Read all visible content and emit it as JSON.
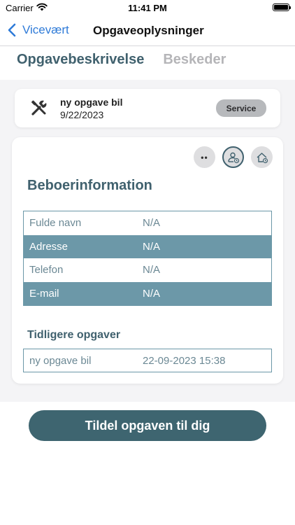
{
  "status_bar": {
    "carrier": "Carrier",
    "time": "11:41 PM",
    "wifi_icon": "wifi-icon",
    "battery_icon": "battery-icon"
  },
  "nav": {
    "back_label": "Vicevært",
    "back_icon": "chevron-left-icon",
    "title": "Opgaveoplysninger",
    "accent_color": "#2f7bd8"
  },
  "tabs": [
    {
      "label": "Opgavebeskrivelse",
      "active": true
    },
    {
      "label": "Beskeder",
      "active": false
    }
  ],
  "task": {
    "icon": "tools-icon",
    "name": "ny opgave bil",
    "date": "9/22/2023",
    "badge": "Service"
  },
  "resident": {
    "actions": [
      "more-icon",
      "person-clock-icon",
      "home-clock-icon"
    ],
    "actions_dots": "••",
    "title": "Beboerinformation",
    "rows": [
      {
        "label": "Fulde navn",
        "value": "N/A"
      },
      {
        "label": "Adresse",
        "value": "N/A"
      },
      {
        "label": "Telefon",
        "value": "N/A"
      },
      {
        "label": "E-mail",
        "value": "N/A"
      }
    ]
  },
  "previous": {
    "title": "Tidligere opgaver",
    "items": [
      {
        "name": "ny opgave bil",
        "datetime": "22-09-2023 15:38"
      }
    ]
  },
  "assign_button": "Tildel opgaven til dig",
  "colors": {
    "primary": "#40616e",
    "row_shade": "#6c98a8",
    "button": "#3e6570",
    "badge": "#b7b9bc"
  }
}
